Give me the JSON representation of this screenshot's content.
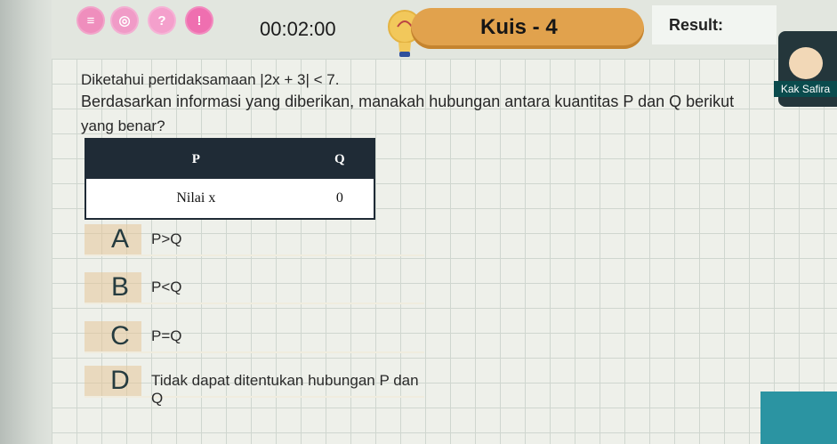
{
  "header": {
    "timer": "00:02:00",
    "quiz_title": "Kuis - 4",
    "result_label": "Result:",
    "name_tag": "Kak Safira"
  },
  "question": {
    "line1": "Diketahui pertidaksamaan |2x + 3| < 7.",
    "line2": "Berdasarkan informasi yang diberikan, manakah hubungan antara kuantitas P dan Q berikut",
    "line3": "yang benar?"
  },
  "table": {
    "headers": [
      "P",
      "Q"
    ],
    "rows": [
      [
        "Nilai x",
        "0"
      ]
    ]
  },
  "options": [
    {
      "letter": "A",
      "text": "P>Q"
    },
    {
      "letter": "B",
      "text": "P<Q"
    },
    {
      "letter": "C",
      "text": "P=Q"
    },
    {
      "letter": "D",
      "text": "Tidak dapat ditentukan hubungan P dan Q"
    }
  ],
  "colors": {
    "pill": "#e1a24d",
    "table_header": "#1f2b36",
    "teal": "#2b94a2"
  },
  "icons": {
    "menu": "menu-icon",
    "target": "target-icon",
    "help": "help-icon",
    "alert": "alert-icon",
    "bulb": "lightbulb-icon"
  }
}
